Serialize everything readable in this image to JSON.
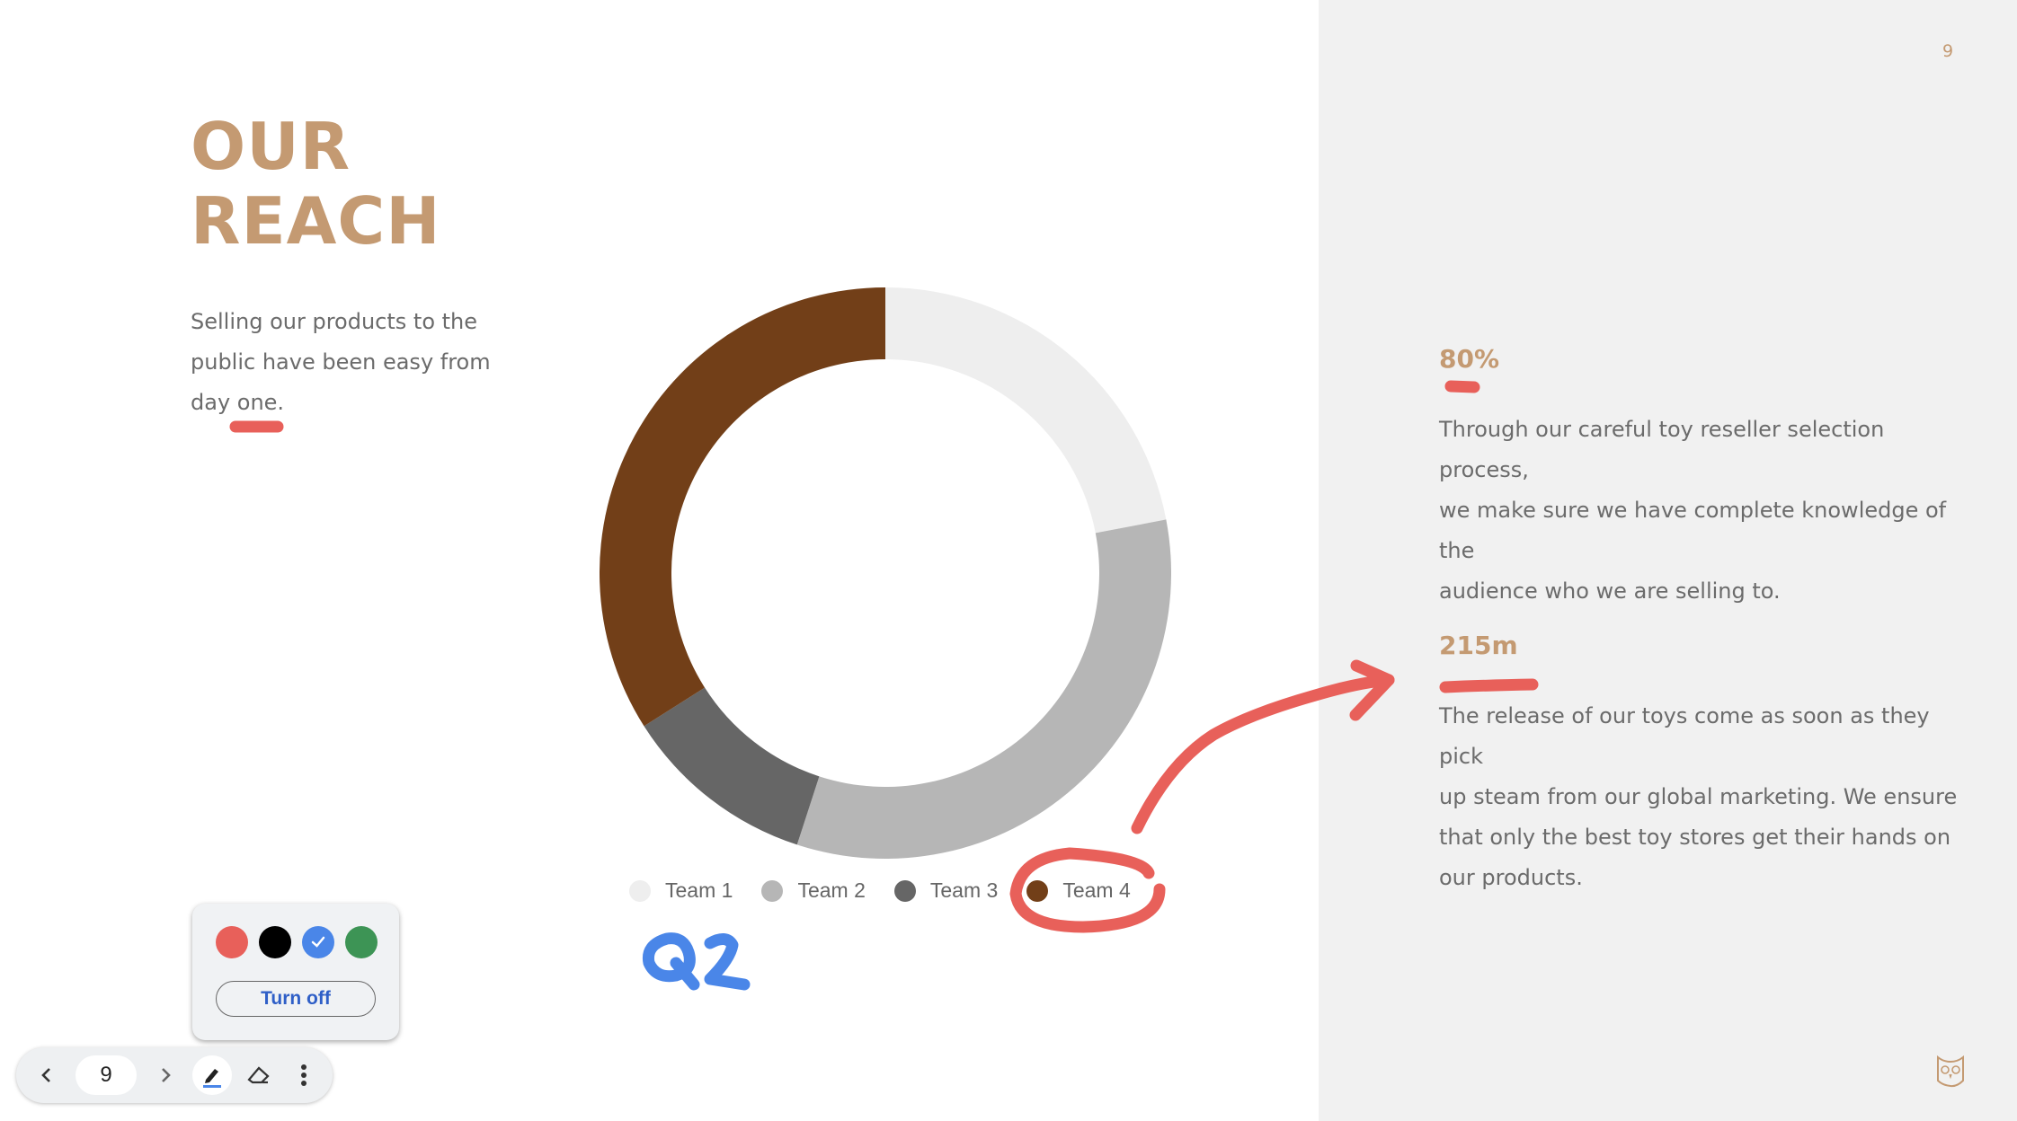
{
  "slide": {
    "page_number": "9",
    "title_line1": "OUR",
    "title_line2": "REACH",
    "subtitle_line1": "Selling our products to the",
    "subtitle_line2": "public have been easy from",
    "subtitle_line3": "day one.",
    "stats": [
      {
        "value": "80%",
        "text_lines": [
          "Through our careful toy reseller selection process,",
          "we make sure we have complete knowledge of the",
          "audience who we are selling to."
        ]
      },
      {
        "value": "215m",
        "text_lines": [
          "The release of our toys come as soon as they pick",
          "up steam from our global marketing. We ensure",
          "that only the best toy stores get their hands on",
          "our products."
        ]
      }
    ],
    "logo_icon": "owl-icon",
    "colors": {
      "accent": "#c49a72",
      "panel": "#f1f1f1",
      "body_text": "#6b6b6b"
    }
  },
  "chart_data": {
    "type": "pie",
    "variant": "donut",
    "title": "",
    "categories": [
      "Team 1",
      "Team 2",
      "Team 3",
      "Team 4"
    ],
    "values": [
      22,
      33,
      11,
      34
    ],
    "unit": "percent (estimated from arc angles)",
    "colors": [
      "#eeeeee",
      "#b6b6b6",
      "#666666",
      "#723f18"
    ],
    "start": "top, clockwise",
    "legend_position": "bottom"
  },
  "annotations": {
    "handwritten_text": "Q2",
    "handwritten_color": "#4a86e8",
    "marker_color": "#e8605a",
    "marks": [
      "underline under 'one'",
      "underline under '80%'",
      "underline under '215m'",
      "circle around 'Team 4' legend entry",
      "arrow from Team 4 toward '215m'"
    ]
  },
  "pen_popover": {
    "colors": [
      {
        "name": "red",
        "hex": "#e8605a",
        "selected": false
      },
      {
        "name": "black",
        "hex": "#000000",
        "selected": false
      },
      {
        "name": "blue",
        "hex": "#4a86e8",
        "selected": true
      },
      {
        "name": "green",
        "hex": "#3d9455",
        "selected": false
      }
    ],
    "turn_off_label": "Turn off"
  },
  "toolbar": {
    "current_page": "9",
    "prev_icon": "chevron-left-icon",
    "next_icon": "chevron-right-icon",
    "pen_icon": "pen-icon",
    "eraser_icon": "eraser-icon",
    "more_icon": "more-vert-icon"
  }
}
